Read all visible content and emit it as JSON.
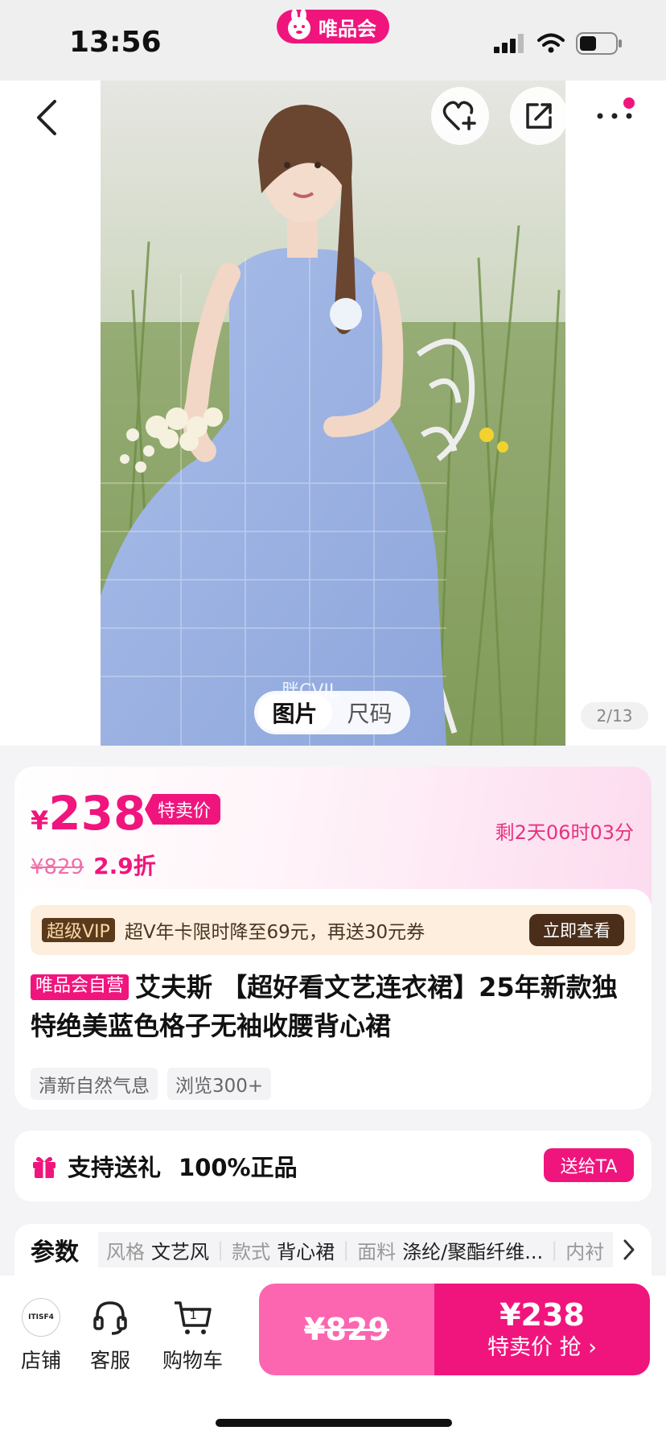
{
  "status_bar": {
    "time": "13:56",
    "brand": "唯品会"
  },
  "gallery": {
    "watermark": "胖CVIL",
    "tabs": [
      "图片",
      "尺码"
    ],
    "pager": "2/13"
  },
  "price": {
    "currency": "¥",
    "amount": "238",
    "tag": "特卖价",
    "original": "¥829",
    "discount": "2.9折",
    "countdown": "剩2天06时03分"
  },
  "vip": {
    "badge": "超级VIP",
    "text": "超V年卡限时降至69元，再送30元券",
    "button": "立即查看"
  },
  "product": {
    "self_tag": "唯品会自营",
    "title": "艾夫斯 【超好看文艺连衣裙】25年新款独特绝美蓝色格子无袖收腰背心裙",
    "chips": [
      "清新自然气息",
      "浏览300+"
    ]
  },
  "gift": {
    "label": "支持送礼",
    "guarantee": "100%正品",
    "button": "送给TA"
  },
  "params": {
    "label": "参数",
    "items": [
      {
        "k": "风格",
        "v": "文艺风"
      },
      {
        "k": "款式",
        "v": "背心裙"
      },
      {
        "k": "面料",
        "v": "涤纶/聚酯纤维..."
      },
      {
        "k": "内衬",
        "v": ""
      }
    ]
  },
  "bottom_bar": {
    "shop_logo": "ITISF4",
    "shop": "店铺",
    "service": "客服",
    "cart": "购物车",
    "cart_count": "1",
    "original_price": "¥829",
    "sale_price": "¥238",
    "buy_label": "特卖价 抢"
  },
  "colors": {
    "accent": "#f0157d",
    "vip_bg": "#fdeedd",
    "vip_dark": "#4a2e1a"
  }
}
